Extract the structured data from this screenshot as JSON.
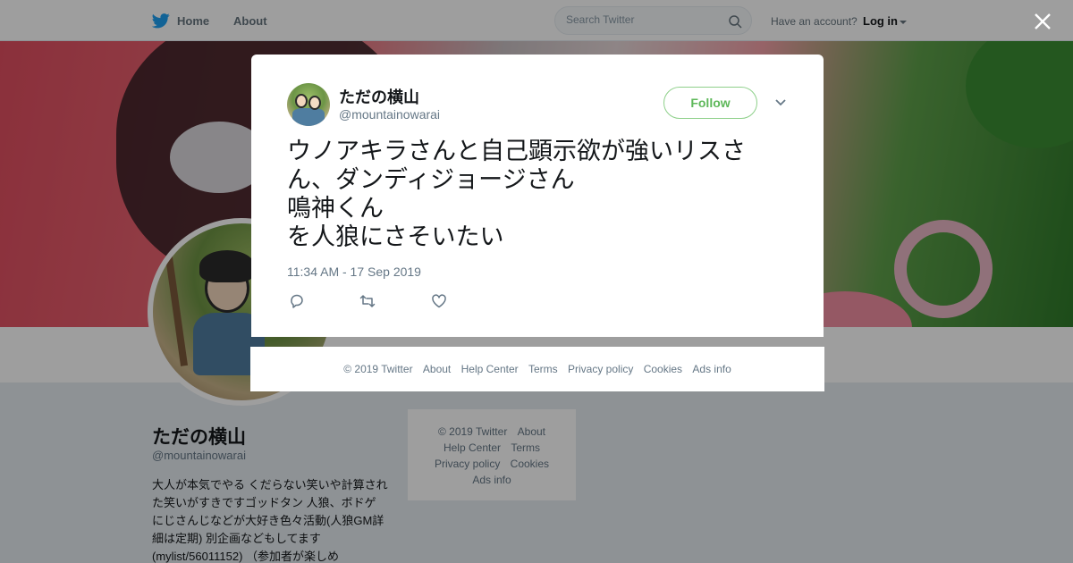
{
  "nav": {
    "home": "Home",
    "about": "About",
    "search_placeholder": "Search Twitter",
    "have_account": "Have an account?",
    "login": "Log in"
  },
  "profile": {
    "name": "ただの横山",
    "handle": "@mountainowarai",
    "bio": "大人が本気でやる くだらない笑いや計算された笑いがすきですゴッドタン 人狼、ボドゲ にじさんじなどが大好き色々活動(人狼GM詳細は定期) 別企画などもしてます(mylist/56011152) （参加者が楽しめ"
  },
  "side_footer": {
    "items": [
      "© 2019 Twitter",
      "About",
      "Help Center",
      "Terms",
      "Privacy policy",
      "Cookies",
      "Ads info"
    ]
  },
  "tweet": {
    "author_name": "ただの横山",
    "author_handle": "@mountainowarai",
    "follow_label": "Follow",
    "text": "ウノアキラさんと自己顕示欲が強いリスさん、ダンディジョージさん\n鳴神くん\nを人狼にさそいたい",
    "timestamp": "11:34 AM - 17 Sep 2019"
  },
  "modal_footer": {
    "items": [
      "© 2019 Twitter",
      "About",
      "Help Center",
      "Terms",
      "Privacy policy",
      "Cookies",
      "Ads info"
    ]
  },
  "icons": {
    "twitter_bird": "twitter-bird-icon",
    "search": "search-icon",
    "close": "close-icon",
    "chevron": "chevron-down-icon",
    "reply": "reply-icon",
    "retweet": "retweet-icon",
    "like": "heart-icon"
  },
  "colors": {
    "twitter_blue": "#1da1f2",
    "follow_green": "#5eb85a",
    "muted": "#657786"
  }
}
